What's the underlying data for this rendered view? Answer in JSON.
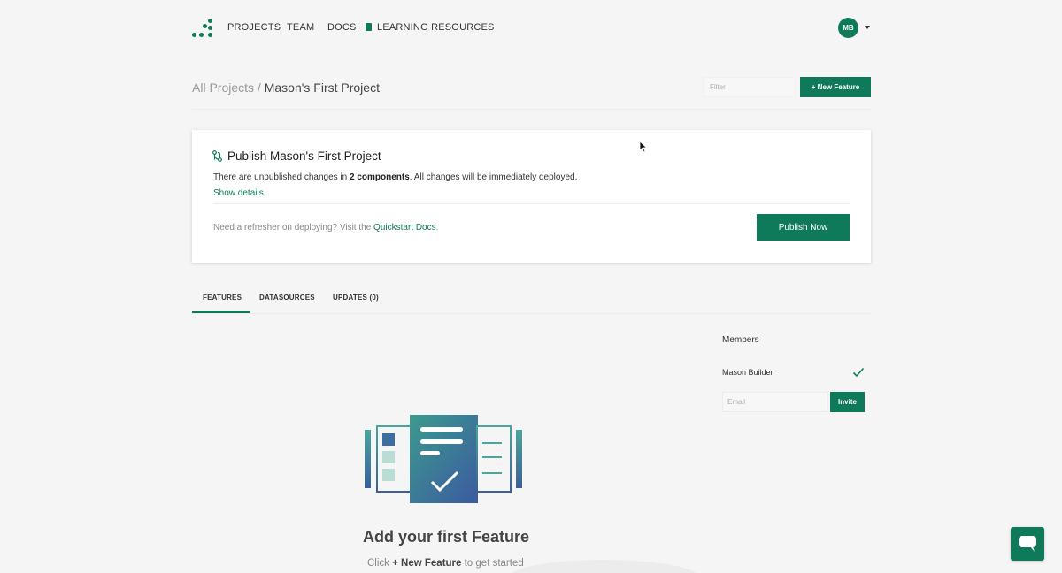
{
  "nav": {
    "links": [
      "PROJECTS",
      "TEAM",
      "DOCS",
      "LEARNING RESOURCES"
    ],
    "avatar_initials": "MB"
  },
  "header": {
    "breadcrumb_root": "All Projects",
    "breadcrumb_sep": "/",
    "breadcrumb_current": "Mason's First Project",
    "filter_placeholder": "Filter",
    "new_feature_label": "+ New Feature"
  },
  "publish": {
    "title": "Publish Mason's First Project",
    "desc_before": "There are unpublished changes in ",
    "desc_bold": "2 components",
    "desc_after": ". All changes will be immediately deployed.",
    "show_details": "Show details",
    "refresher_text": "Need a refresher on deploying? Visit the ",
    "refresher_link": "Quickstart Docs",
    "refresher_end": ".",
    "publish_now": "Publish Now"
  },
  "tabs": [
    "FEATURES",
    "DATASOURCES",
    "UPDATES (0)"
  ],
  "members": {
    "title": "Members",
    "list": [
      "Mason Builder"
    ],
    "email_placeholder": "Email",
    "invite_label": "Invite"
  },
  "empty_state": {
    "title": "Add your first Feature",
    "sub_before": "Click ",
    "sub_bold": "+ New Feature",
    "sub_after": " to get started"
  },
  "colors": {
    "accent": "#0f7a5a",
    "background": "#f5f5f5"
  },
  "icons": [
    "logo-dots-icon",
    "book-icon",
    "caret-down-icon",
    "publish-branch-icon",
    "check-icon",
    "chat-icon",
    "mouse-cursor-icon"
  ]
}
